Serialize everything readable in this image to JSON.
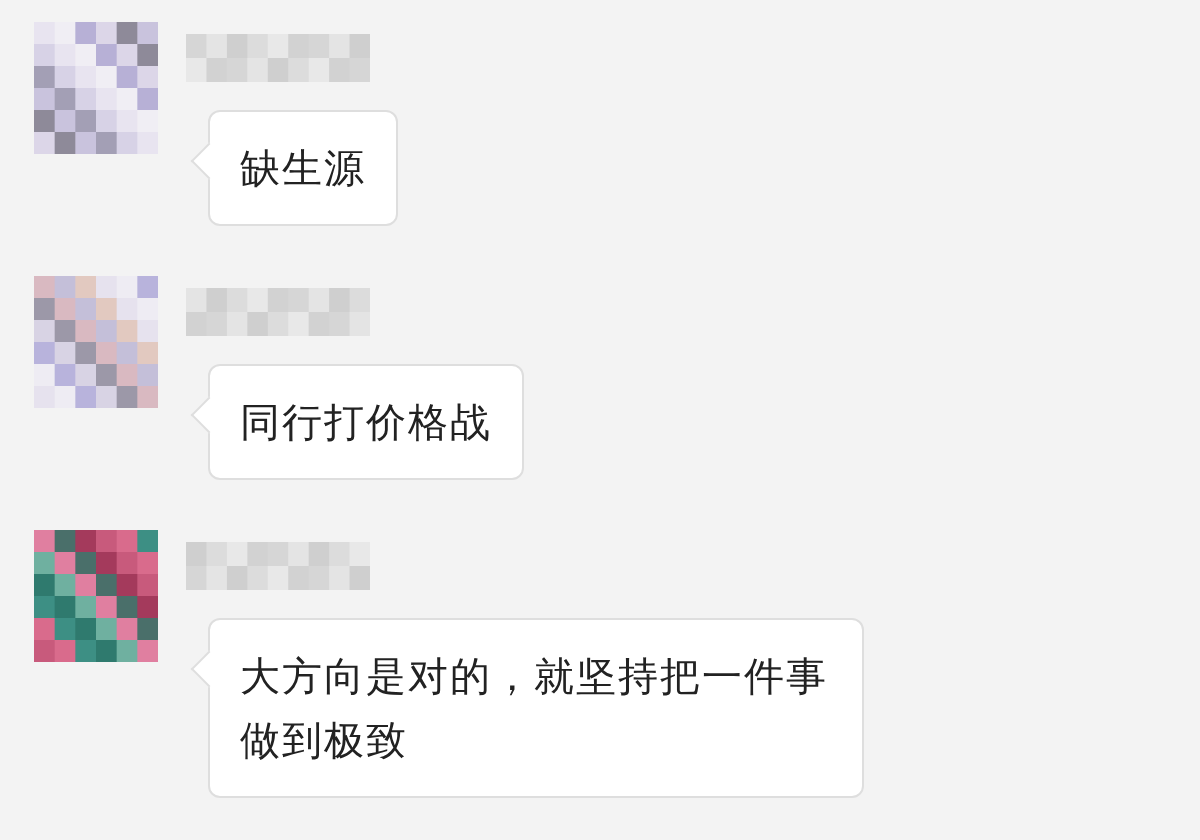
{
  "messages": [
    {
      "text": "缺生源"
    },
    {
      "text": "同行打价格战"
    },
    {
      "text": "大方向是对的，就坚持把一件事做到极致"
    }
  ]
}
